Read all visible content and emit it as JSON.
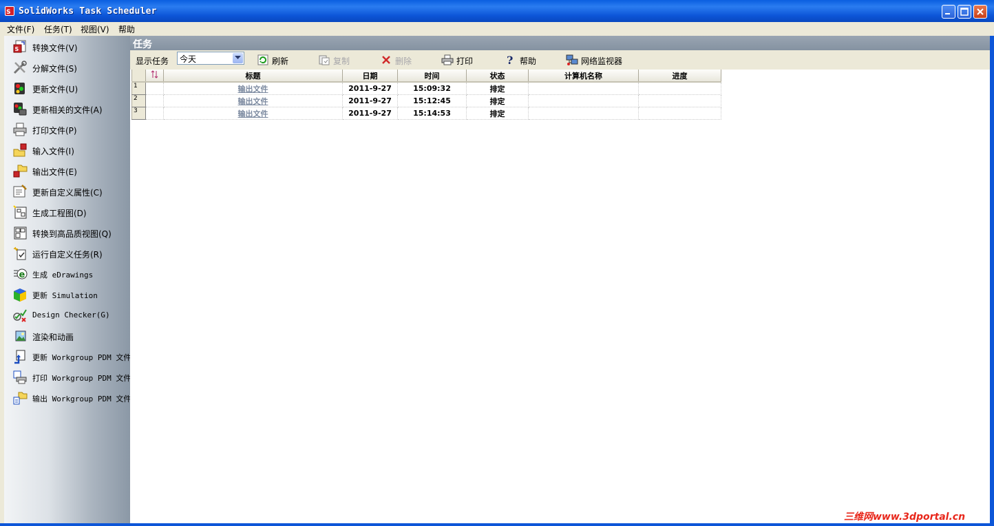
{
  "window": {
    "title": "SolidWorks Task Scheduler",
    "accent": "#0d56d8"
  },
  "menu": {
    "file": "文件(F)",
    "task": "任务(T)",
    "view": "视图(V)",
    "help": "帮助"
  },
  "sidebar": {
    "items": [
      {
        "label": "转换文件(V)",
        "icon": "convert-file-icon"
      },
      {
        "label": "分解文件(S)",
        "icon": "tools-icon"
      },
      {
        "label": "更新文件(U)",
        "icon": "update-file-icon"
      },
      {
        "label": "更新相关的文件(A)",
        "icon": "update-related-icon"
      },
      {
        "label": "打印文件(P)",
        "icon": "printer-icon"
      },
      {
        "label": "输入文件(I)",
        "icon": "import-folder-icon"
      },
      {
        "label": "输出文件(E)",
        "icon": "export-folder-icon"
      },
      {
        "label": "更新自定义属性(C)",
        "icon": "custom-properties-icon"
      },
      {
        "label": "生成工程图(D)",
        "icon": "drawing-icon"
      },
      {
        "label": "转换到高品质视图(Q)",
        "icon": "hq-view-icon"
      },
      {
        "label": "运行自定义任务(R)",
        "icon": "custom-task-icon"
      },
      {
        "label": "生成 eDrawings",
        "icon": "edrawings-icon"
      },
      {
        "label": "更新 Simulation",
        "icon": "simulation-cube-icon"
      },
      {
        "label": "Design Checker(G)",
        "icon": "design-checker-icon"
      },
      {
        "label": "渲染和动画",
        "icon": "render-image-icon"
      },
      {
        "label": "更新 Workgroup PDM 文件",
        "icon": "pdm-update-icon"
      },
      {
        "label": "打印 Workgroup PDM 文件",
        "icon": "pdm-print-icon"
      },
      {
        "label": "输出 Workgroup PDM 文件",
        "icon": "pdm-export-icon"
      }
    ]
  },
  "panel": {
    "title": "任务"
  },
  "toolbar": {
    "show_label": "显示任务",
    "filter_value": "今天",
    "refresh": "刷新",
    "copy": "复制",
    "delete": "删除",
    "print": "打印",
    "help": "帮助",
    "network_monitor": "网络监视器"
  },
  "table": {
    "columns": [
      "标题",
      "日期",
      "时间",
      "状态",
      "计算机名称",
      "进度"
    ],
    "rows": [
      {
        "num": "1",
        "title": "输出文件",
        "date": "2011-9-27",
        "time": "15:09:32",
        "status": "排定",
        "computer": "",
        "progress": ""
      },
      {
        "num": "2",
        "title": "输出文件",
        "date": "2011-9-27",
        "time": "15:12:45",
        "status": "排定",
        "computer": "",
        "progress": ""
      },
      {
        "num": "3",
        "title": "输出文件",
        "date": "2011-9-27",
        "time": "15:14:53",
        "status": "排定",
        "computer": "",
        "progress": ""
      }
    ]
  },
  "watermark": "三维网www.3dportal.cn"
}
